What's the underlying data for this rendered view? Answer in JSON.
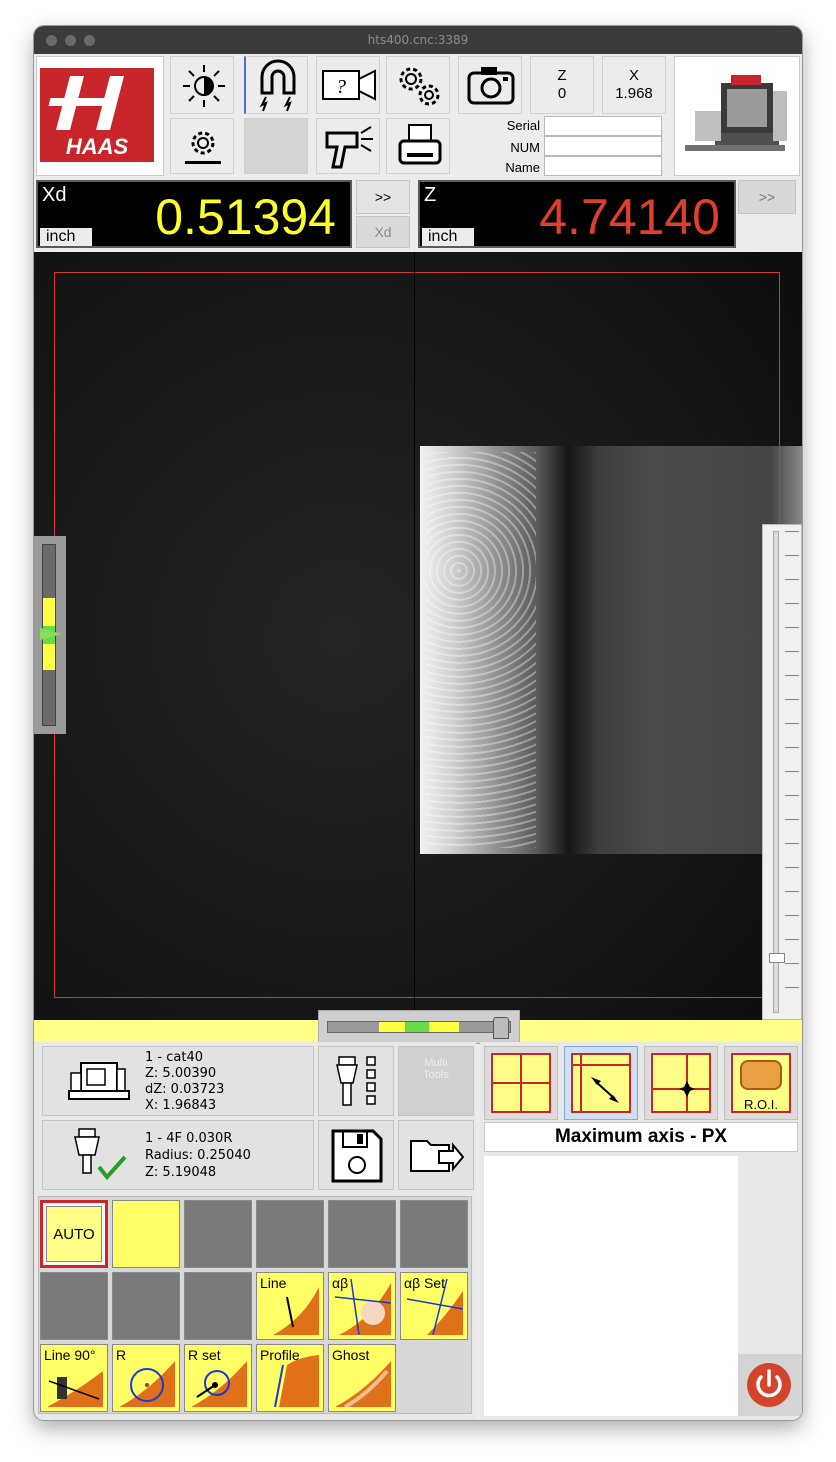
{
  "window": {
    "title": "hts400.cnc:3389"
  },
  "logo": {
    "text": "HAAS"
  },
  "toolbar": {
    "icons": [
      "brightness-icon",
      "magnet-icon",
      "help-video-icon",
      "settings-gears-icon",
      "camera-icon",
      "display-settings-icon",
      "probe-gun-icon",
      "printer-icon"
    ],
    "z_label": "Z",
    "z_value": "0",
    "x_label": "X",
    "x_value": "1.968",
    "serial_label": "Serial",
    "num_label": "NUM",
    "name_label": "Name",
    "serial_value": "",
    "num_value": "",
    "name_value": ""
  },
  "readouts": {
    "xd": {
      "label": "Xd",
      "value": "0.51394",
      "unit": "inch",
      "color": "#ffff2a"
    },
    "xd_next": ">>",
    "xd_sel": "Xd",
    "z": {
      "label": "Z",
      "value": "4.74140",
      "unit": "inch",
      "color": "#e0402a"
    },
    "z_next": ">>"
  },
  "machine": {
    "tool": "1 - cat40",
    "z": "Z: 5.00390",
    "dz": "dZ: 0.03723",
    "x": "X: 1.96843"
  },
  "tool_info": {
    "name": "1 - 4F 0.030R",
    "radius": "Radius: 0.25040",
    "z": "Z: 5.19048"
  },
  "multi_tools": "Multi\nTools",
  "measure": {
    "auto": "AUTO",
    "line": "Line",
    "ab": "αβ",
    "ab_set": "αβ Set",
    "line90": "Line 90°",
    "r": "R",
    "r_set": "R set",
    "profile": "Profile",
    "ghost": "Ghost"
  },
  "view_modes": {
    "roi": "R.O.I.",
    "status": "Maximum axis - PX"
  }
}
